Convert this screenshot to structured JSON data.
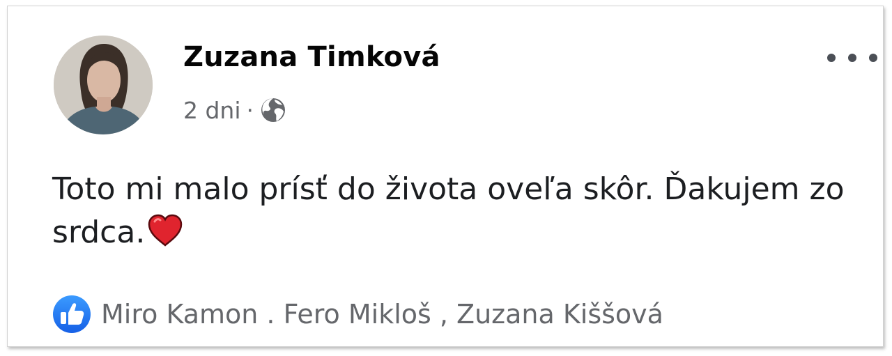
{
  "post": {
    "author": "Zuzana Timková",
    "time": "2 dni",
    "separator": "·",
    "privacy_icon": "globe-icon",
    "more_icon": "more-dots-icon",
    "text": "Toto mi malo prísť do života oveľa skôr. Ďakujem zo srdca.",
    "emoji": "heart-icon",
    "reaction_icon": "like-icon",
    "reactors": "Miro Kamon . Fero Mikloš , Zuzana Kiššová"
  },
  "colors": {
    "name": "#050505",
    "secondary_text": "#65676b",
    "body_text": "#1c1e21",
    "like_blue": "#1877f2",
    "heart_red": "#e0242e"
  }
}
